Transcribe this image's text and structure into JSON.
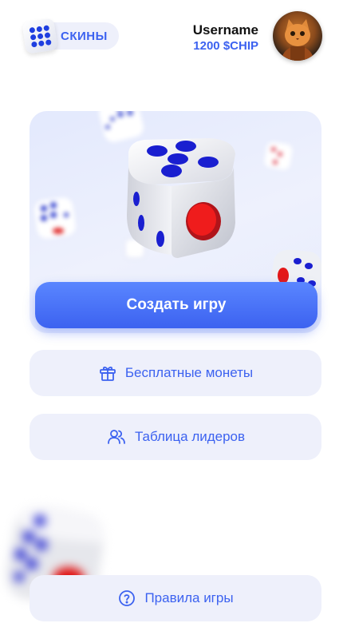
{
  "header": {
    "skins_label": "СКИНЫ",
    "username": "Username",
    "balance": "1200 $CHIP"
  },
  "hero": {
    "create_label": "Создать игру"
  },
  "menu": {
    "free_coins_label": "Бесплатные монеты",
    "leaderboard_label": "Таблица лидеров",
    "rules_label": "Правила игры"
  },
  "colors": {
    "accent": "#3c62f0",
    "button_bg": "#eef0fb",
    "pip_blue": "#1f2fd6",
    "pip_red": "#e3121a"
  }
}
